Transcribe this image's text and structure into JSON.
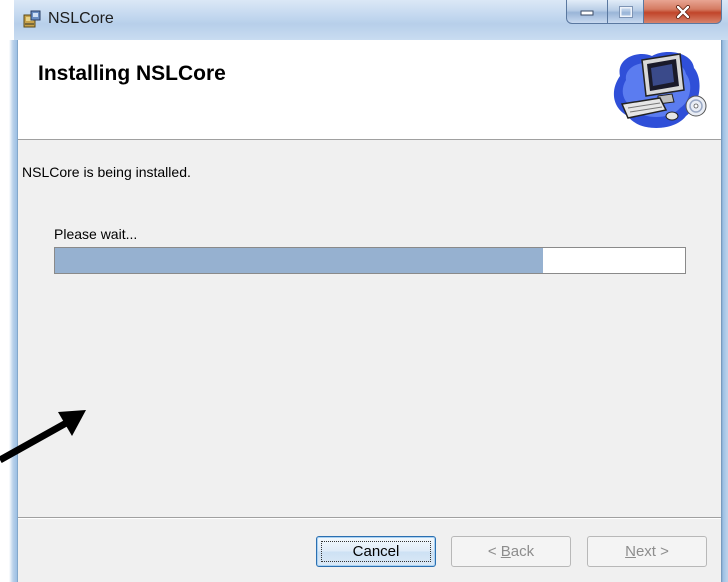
{
  "window": {
    "title": "NSLCore",
    "icon": "installer-icon"
  },
  "banner": {
    "title": "Installing NSLCore",
    "icon": "computer-setup-icon"
  },
  "body": {
    "status": "NSLCore is being installed.",
    "wait_label": "Please wait...",
    "progress_fraction": 0.775
  },
  "buttons": {
    "cancel": "Cancel",
    "back_prefix": "< ",
    "back_accel": "B",
    "back_rest": "ack",
    "next_accel": "N",
    "next_rest": "ext >"
  },
  "overlay": {
    "annotation": "arrow-pointer-icon"
  },
  "colors": {
    "progress_fill": "#96b1d0",
    "close_button": "#c1452a",
    "client_background": "#f0f0f0"
  }
}
